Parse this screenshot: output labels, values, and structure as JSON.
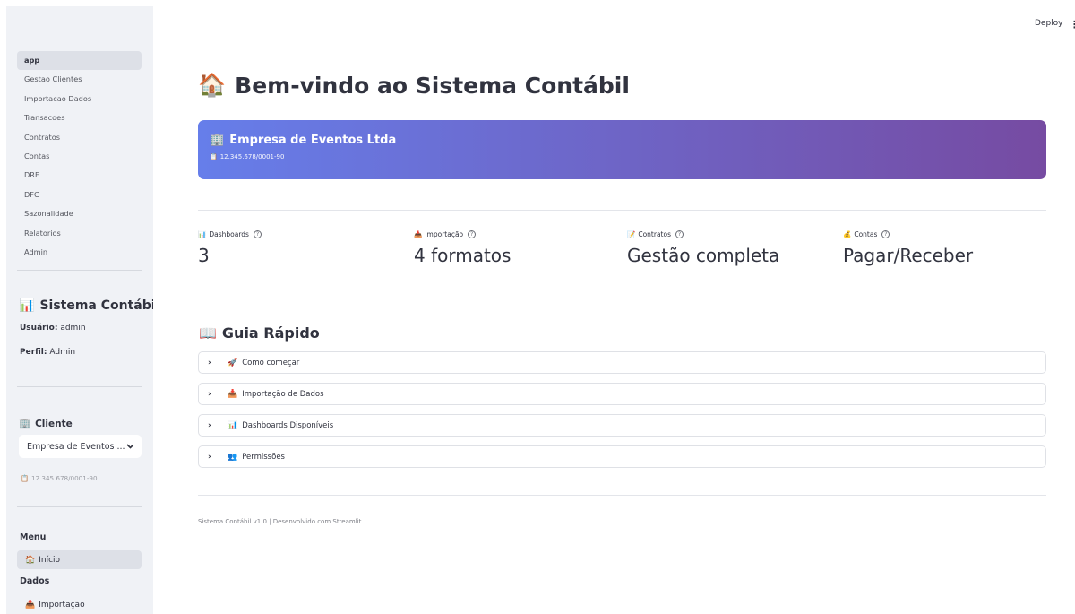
{
  "topbar": {
    "deploy_label": "Deploy",
    "menu_glyph": "⋮"
  },
  "sidebar": {
    "nav_items": [
      "app",
      "Gestao Clientes",
      "Importacao Dados",
      "Transacoes",
      "Contratos",
      "Contas",
      "DRE",
      "DFC",
      "Sazonalidade",
      "Relatorios",
      "Admin"
    ],
    "active_nav": "app",
    "title": "Sistema Contábil",
    "title_icon": "📊",
    "user_label": "Usuário:",
    "user_value": "admin",
    "profile_label": "Perfil:",
    "profile_value": "Admin",
    "client_heading": "Cliente",
    "client_icon": "🏢",
    "client_select_value": "Empresa de Eventos ...",
    "client_cnpj": "12.345.678/0001-90",
    "menu_heading": "Menu",
    "menu_inicio": "Início",
    "menu_inicio_icon": "🏠",
    "dados_heading": "Dados",
    "menu_importacao": "Importação",
    "menu_importacao_icon": "📥"
  },
  "main": {
    "title": "Bem-vindo ao Sistema Contábil",
    "title_icon": "🏠",
    "banner": {
      "company": "Empresa de Eventos Ltda",
      "company_icon": "🏢",
      "cnpj": "12.345.678/0001-90",
      "cnpj_icon": "📋",
      "gradient_start": "#667eea",
      "gradient_end": "#764ba2"
    },
    "metrics": [
      {
        "icon": "📊",
        "label": "Dashboards",
        "value": "3"
      },
      {
        "icon": "📥",
        "label": "Importação",
        "value": "4 formatos"
      },
      {
        "icon": "📝",
        "label": "Contratos",
        "value": "Gestão completa"
      },
      {
        "icon": "💰",
        "label": "Contas",
        "value": "Pagar/Receber"
      }
    ],
    "guide_title": "Guia Rápido",
    "guide_icon": "📖",
    "expanders": [
      {
        "icon": "🚀",
        "label": "Como começar"
      },
      {
        "icon": "📥",
        "label": "Importação de Dados"
      },
      {
        "icon": "📊",
        "label": "Dashboards Disponíveis"
      },
      {
        "icon": "👥",
        "label": "Permissões"
      }
    ],
    "footer": "Sistema Contábil v1.0 | Desenvolvido com Streamlit"
  }
}
